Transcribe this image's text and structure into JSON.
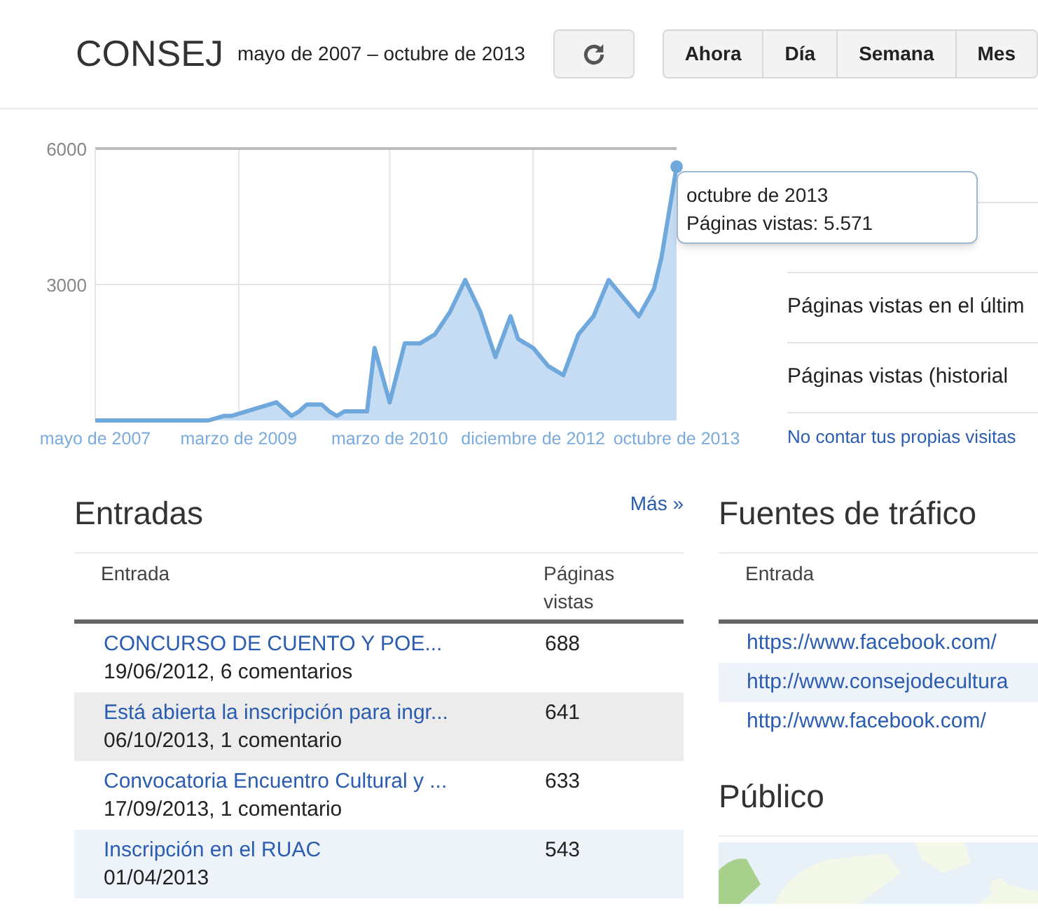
{
  "header": {
    "title": "CONSEJ",
    "date_range": "mayo de 2007 – octubre de 2013",
    "periods": [
      {
        "label": "Ahora"
      },
      {
        "label": "Día"
      },
      {
        "label": "Semana"
      },
      {
        "label": "Mes"
      }
    ]
  },
  "chart": {
    "chart_data": {
      "type": "area",
      "categories": [
        "mayo de 2007",
        null,
        null,
        null,
        null,
        null,
        null,
        null,
        null,
        null,
        null,
        null,
        null,
        null,
        null,
        null,
        null,
        null,
        null,
        "marzo de 2009",
        null,
        null,
        null,
        null,
        null,
        null,
        null,
        null,
        null,
        null,
        null,
        null,
        null,
        null,
        null,
        null,
        null,
        null,
        null,
        "marzo de 2010",
        null,
        null,
        null,
        null,
        null,
        null,
        null,
        null,
        null,
        null,
        null,
        null,
        null,
        null,
        null,
        null,
        null,
        null,
        "diciembre de 2012",
        null,
        null,
        null,
        null,
        null,
        null,
        null,
        null,
        null,
        null,
        null,
        null,
        null,
        null,
        null,
        null,
        null,
        null,
        "octubre de 2013"
      ],
      "series": [
        {
          "color": "#6fa8dc",
          "values": [
            0,
            0,
            0,
            0,
            0,
            0,
            0,
            0,
            0,
            0,
            0,
            0,
            0,
            0,
            0,
            0,
            50,
            100,
            100,
            150,
            200,
            250,
            300,
            350,
            400,
            250,
            100,
            200,
            350,
            350,
            350,
            200,
            100,
            200,
            200,
            200,
            200,
            1600,
            1000,
            400,
            1050,
            1700,
            1700,
            1700,
            1800,
            1900,
            2150,
            2400,
            2750,
            3100,
            2750,
            2400,
            1900,
            1400,
            1850,
            2300,
            1800,
            1700,
            1600,
            1400,
            1200,
            1100,
            1000,
            1450,
            1900,
            2100,
            2300,
            2700,
            3100,
            2900,
            2700,
            2500,
            2300,
            2600,
            2900,
            3600,
            4600,
            5600
          ]
        }
      ],
      "grid": true,
      "ylim": [
        0,
        6000
      ],
      "yticks": [
        3000,
        6000
      ]
    },
    "tooltip": {
      "title": "octubre de 2013",
      "text": "Páginas vistas: 5.571"
    }
  },
  "stats": {
    "items": [
      "Páginas vistas en el últim",
      "Páginas vistas (historial"
    ],
    "link": "No contar tus propias visitas"
  },
  "entradas": {
    "title": "Entradas",
    "more": "Más »",
    "columns": [
      "Entrada",
      "Páginas vistas"
    ],
    "rows": [
      {
        "title": "CONCURSO DE CUENTO Y POE...",
        "meta": "19/06/2012, 6 comentarios",
        "views": "688"
      },
      {
        "title": "Está abierta la inscripción para ingr...",
        "meta": "06/10/2013, 1 comentario",
        "views": "641"
      },
      {
        "title": "Convocatoria Encuentro Cultural y ...",
        "meta": "17/09/2013, 1 comentario",
        "views": "633"
      },
      {
        "title": "Inscripción en el RUAC",
        "meta": "01/04/2013",
        "views": "543"
      }
    ]
  },
  "fuentes": {
    "title": "Fuentes de tráfico",
    "columns": [
      "Entrada"
    ],
    "rows": [
      "https://www.facebook.com/",
      "http://www.consejodecultura",
      "http://www.facebook.com/"
    ]
  },
  "publico": {
    "title": "Público"
  }
}
